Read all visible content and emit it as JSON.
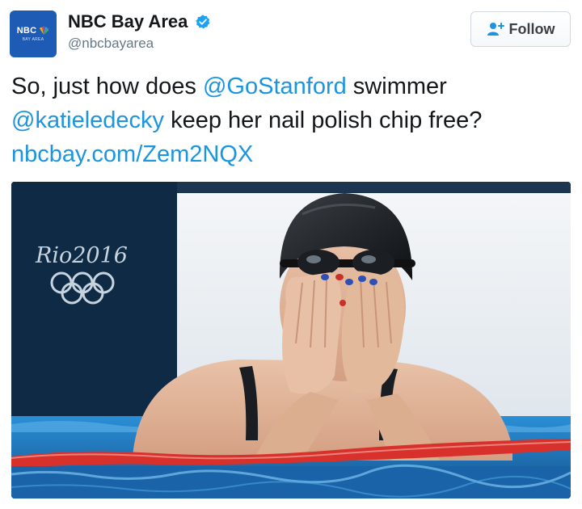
{
  "account": {
    "display_name": "NBC Bay Area",
    "handle": "@nbcbayarea",
    "avatar_logo": "NBC",
    "avatar_subtitle": "BAY AREA",
    "verified": true
  },
  "follow_button": {
    "label": "Follow",
    "icon": "add-user-icon"
  },
  "tweet": {
    "segments": [
      {
        "text": "So, just how does ",
        "link": false
      },
      {
        "text": "@GoStanford",
        "link": true
      },
      {
        "text": " swimmer ",
        "link": false
      },
      {
        "text": "@katieledecky",
        "link": true
      },
      {
        "text": " keep her nail polish chip free? ",
        "link": false
      },
      {
        "text": "nbcbay.com/Zem2NQX",
        "link": true
      }
    ]
  },
  "photo": {
    "signage": "Rio2016"
  },
  "colors": {
    "link": "#1b95e0",
    "verified": "#1da1f2",
    "avatar_bg": "#1d5bb5",
    "pool_water": "#1f6fb8",
    "lane_rope": "#d8302a"
  }
}
